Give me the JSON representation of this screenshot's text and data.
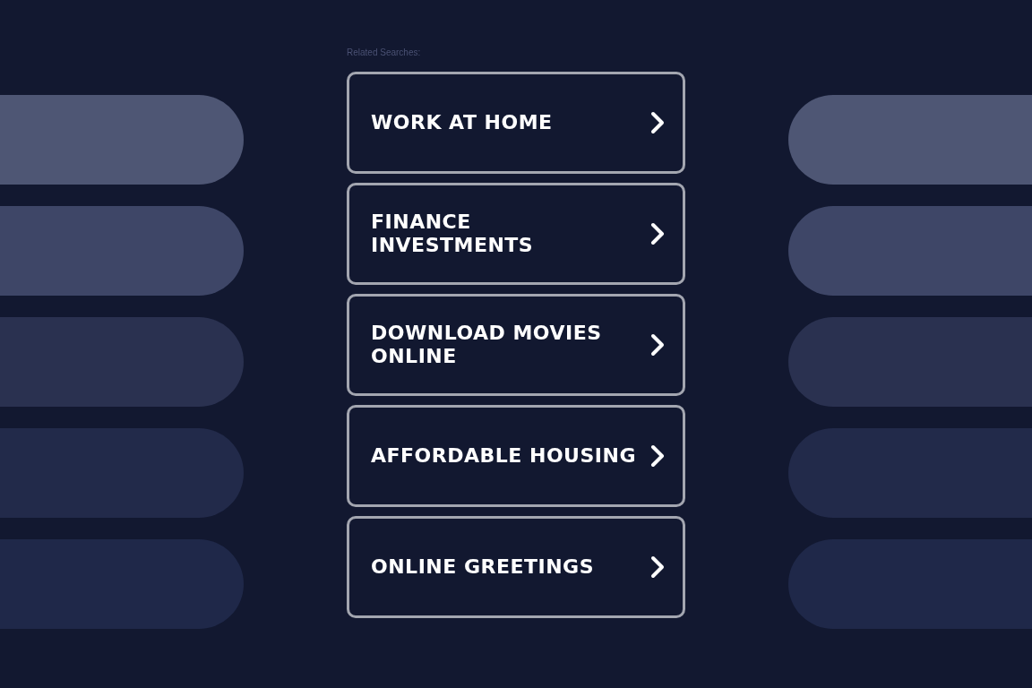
{
  "related_label": "Related Searches:",
  "links": [
    {
      "label": "WORK AT HOME"
    },
    {
      "label": "FINANCE INVESTMENTS"
    },
    {
      "label": "DOWNLOAD MOVIES ONLINE"
    },
    {
      "label": "AFFORDABLE HOUSING"
    },
    {
      "label": "ONLINE GREETINGS"
    }
  ]
}
